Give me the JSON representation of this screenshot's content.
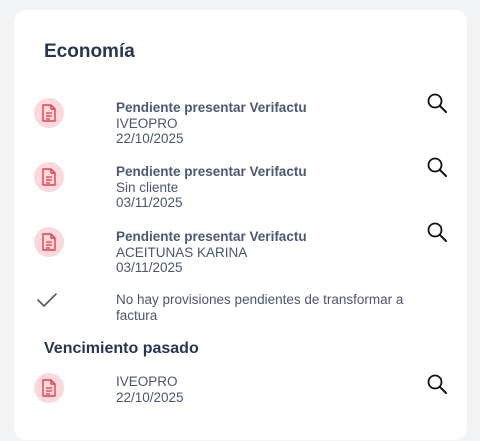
{
  "sections": {
    "economia": {
      "title": "Economía",
      "items": [
        {
          "status": "Pendiente presentar Verifactu",
          "client": "IVEOPRO",
          "date": "22/10/2025"
        },
        {
          "status": "Pendiente presentar Verifactu",
          "client": "Sin cliente",
          "date": "03/11/2025"
        },
        {
          "status": "Pendiente presentar Verifactu",
          "client": "ACEITUNAS KARINA",
          "date": "03/11/2025"
        }
      ],
      "notice": "No hay provisiones pendientes de transformar a factura"
    },
    "vencimiento": {
      "title": "Vencimiento pasado",
      "items": [
        {
          "client": "IVEOPRO",
          "date": "22/10/2025"
        }
      ]
    }
  },
  "icons": {
    "document": "document-icon",
    "search": "search-icon",
    "check": "check-icon"
  },
  "colors": {
    "icon_bg": "#fbd8db",
    "icon_stroke": "#e0404e",
    "heading": "#2a3550",
    "text": "#4a5570"
  }
}
